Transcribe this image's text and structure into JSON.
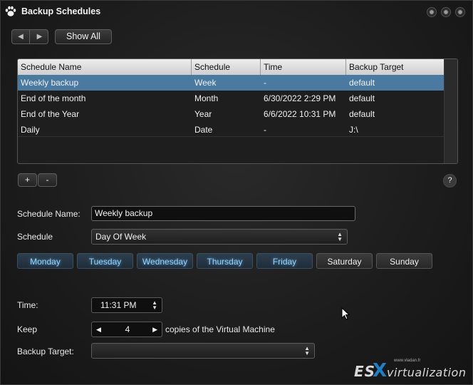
{
  "window": {
    "title": "Backup Schedules",
    "icon": "paw-icon"
  },
  "toolbar": {
    "back_icon": "◀",
    "forward_icon": "▶",
    "show_all_label": "Show All"
  },
  "table": {
    "columns": [
      "Schedule Name",
      "Schedule",
      "Time",
      "Backup Target"
    ],
    "rows": [
      {
        "name": "Weekly backup",
        "schedule": "Week",
        "time": "-",
        "target": "default",
        "selected": true
      },
      {
        "name": "End of the month",
        "schedule": "Month",
        "time": "6/30/2022 2:29 PM",
        "target": "default",
        "selected": false
      },
      {
        "name": "End of the Year",
        "schedule": "Year",
        "time": "6/6/2022 10:31 PM",
        "target": "default",
        "selected": false
      },
      {
        "name": "Daily",
        "schedule": "Date",
        "time": "-",
        "target": "J:\\",
        "selected": false
      }
    ]
  },
  "list_controls": {
    "add_label": "+",
    "remove_label": "-",
    "help_label": "?"
  },
  "form": {
    "schedule_name_label": "Schedule Name:",
    "schedule_name_value": "Weekly backup",
    "schedule_label": "Schedule",
    "schedule_value": "Day Of Week",
    "days": [
      {
        "label": "Monday",
        "selected": true
      },
      {
        "label": "Tuesday",
        "selected": true
      },
      {
        "label": "Wednesday",
        "selected": true
      },
      {
        "label": "Thursday",
        "selected": true
      },
      {
        "label": "Friday",
        "selected": true
      },
      {
        "label": "Saturday",
        "selected": false
      },
      {
        "label": "Sunday",
        "selected": false
      }
    ],
    "time_label": "Time:",
    "time_value": "11:31 PM",
    "keep_label": "Keep",
    "keep_value": "4",
    "keep_suffix": "copies of the Virtual Machine",
    "backup_target_label": "Backup Target:",
    "backup_target_value": ""
  },
  "watermark": {
    "es": "ES",
    "x": "X",
    "rest": "virtualization",
    "small": "www.vladan.fr"
  },
  "colors": {
    "selected_row": "#4a7aa0",
    "day_on_text": "#9fd0f2",
    "watermark_x": "#1d7fc7"
  }
}
